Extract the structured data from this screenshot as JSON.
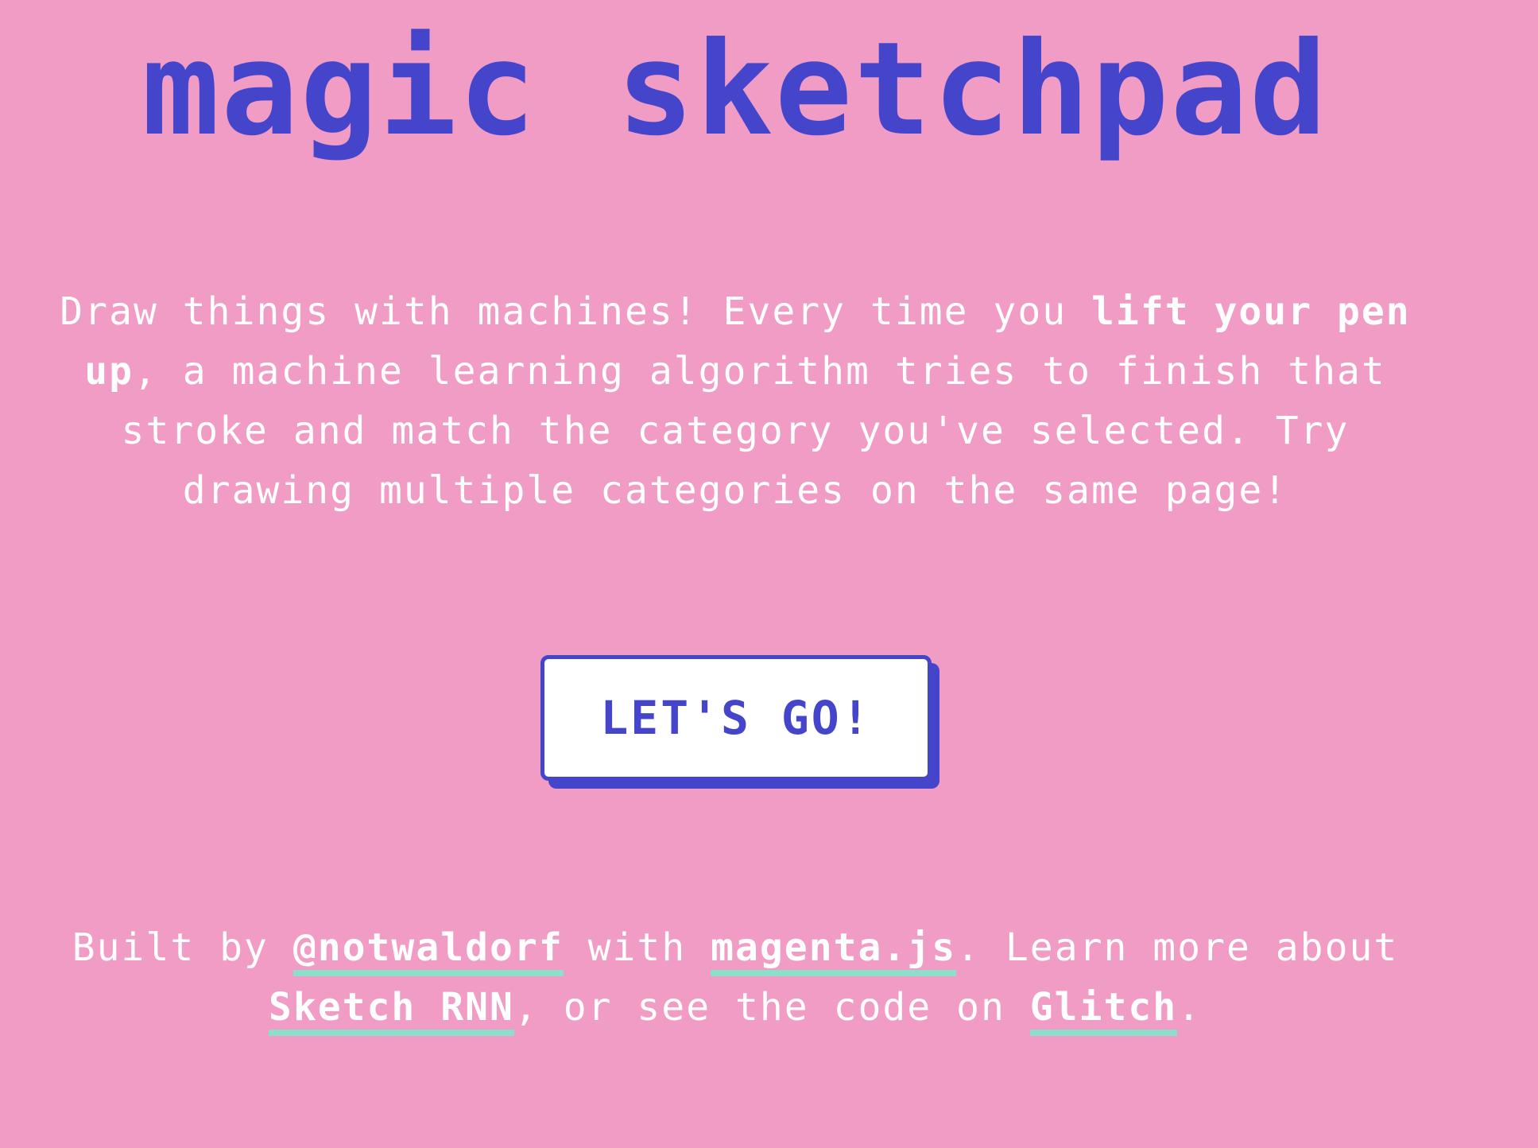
{
  "header": {
    "title": "magic sketchpad"
  },
  "intro": {
    "text_before": "Draw things with machines! Every time you ",
    "emphasis": "lift your pen up",
    "text_after": ", a machine learning algorithm tries to finish that stroke and match the category you've selected. Try drawing multiple categories on the same page!"
  },
  "cta": {
    "label": "LET'S GO!"
  },
  "credits": {
    "built_by": "Built by ",
    "author_link": "@notwaldorf",
    "with": " with ",
    "library_link": "magenta.js",
    "learn_more": ". Learn more about ",
    "model_link": "Sketch RNN",
    "or_see": ", or see the code on ",
    "code_link": "Glitch",
    "end": "."
  },
  "colors": {
    "background": "#f19cc5",
    "accent": "#4545cc",
    "link_underline": "#8ddfcb",
    "text": "#ffffff"
  }
}
